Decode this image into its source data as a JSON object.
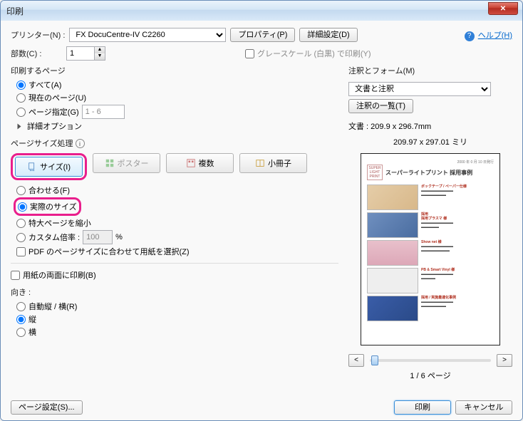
{
  "window": {
    "title": "印刷"
  },
  "top": {
    "printer_label": "プリンター(N) :",
    "printer_value": "FX DocuCentre-IV C2260",
    "properties_btn": "プロパティ(P)",
    "advanced_btn": "詳細設定(D)",
    "help_link": "ヘルプ(H)",
    "copies_label": "部数(C) :",
    "copies_value": "1",
    "grayscale_label": "グレースケール (白黒) で印刷(Y)"
  },
  "pages": {
    "section": "印刷するページ",
    "all": "すべて(A)",
    "current": "現在のページ(U)",
    "range": "ページ指定(G)",
    "range_value": "1 - 6",
    "more_options": "詳細オプション"
  },
  "sizing": {
    "section": "ページサイズ処理",
    "tab_size": "サイズ(I)",
    "tab_poster": "ポスター",
    "tab_multiple": "複数",
    "tab_booklet": "小冊子",
    "fit": "合わせる(F)",
    "actual": "実際のサイズ",
    "shrink": "特大ページを縮小",
    "custom": "カスタム倍率 :",
    "custom_value": "100",
    "custom_unit": "%",
    "paper_source": "PDF のページサイズに合わせて用紙を選択(Z)"
  },
  "duplex": {
    "label": "用紙の両面に印刷(B)"
  },
  "orientation": {
    "section": "向き :",
    "auto": "自動縦 / 横(R)",
    "portrait": "縦",
    "landscape": "横"
  },
  "comments": {
    "section": "注釈とフォーム(M)",
    "select_value": "文書と注釈",
    "summary_btn": "注釈の一覧(T)",
    "doc_size": "文書 : 209.9 x 296.7mm",
    "preview_size": "209.97 x 297.01 ミリ",
    "preview_title": "スーパーライトプリント 採用事例",
    "page_indicator": "1 / 6 ページ",
    "nav_prev": "<",
    "nav_next": ">"
  },
  "footer": {
    "page_setup": "ページ設定(S)...",
    "print": "印刷",
    "cancel": "キャンセル"
  }
}
